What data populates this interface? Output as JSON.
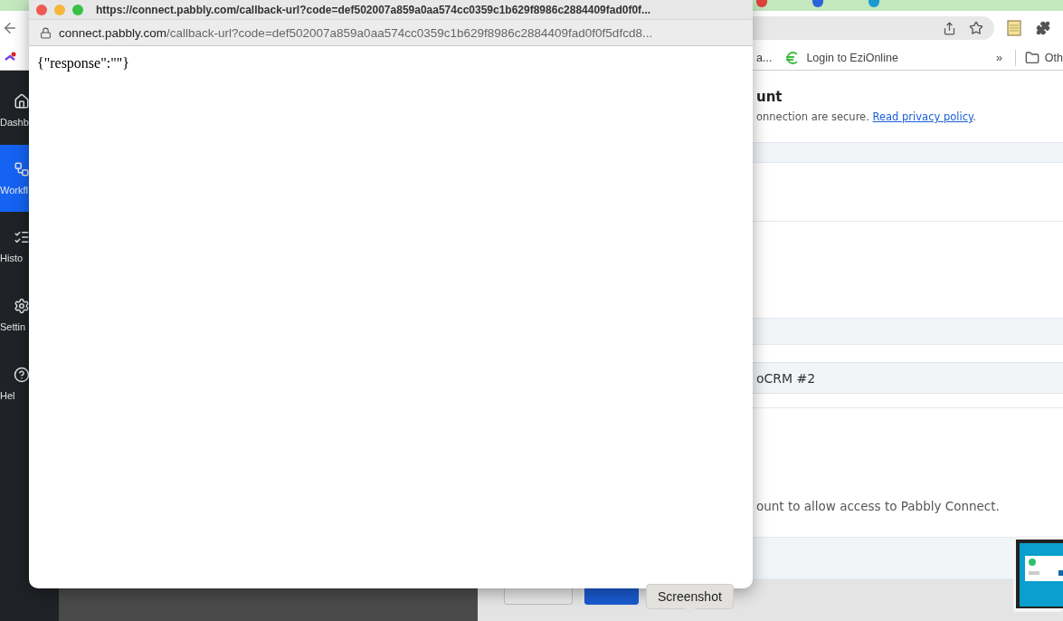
{
  "browser": {
    "bookmarks": [
      {
        "label": "a..."
      },
      {
        "label": "Login to EziOnline"
      }
    ],
    "overflow": "»",
    "other_bookmarks": "Oth"
  },
  "sidebar": {
    "items": [
      {
        "kind": "home",
        "label": "Dashb",
        "selected": false
      },
      {
        "kind": "workflow",
        "label": "Workfl",
        "selected": true
      },
      {
        "kind": "history",
        "label": "Histo",
        "selected": false
      },
      {
        "kind": "settings",
        "label": "Settin",
        "selected": false
      },
      {
        "kind": "help",
        "label": "Hel",
        "selected": false
      }
    ]
  },
  "page": {
    "heading": "unt",
    "notice": "onnection are secure. ",
    "privacy_link": "Read privacy policy",
    "notice_end": ".",
    "app_name": "oCRM #2",
    "instruction": "ount to allow access to Pabbly Connect."
  },
  "popup": {
    "title": "https://connect.pabbly.com/callback-url?code=def502007a859a0aa574cc0359c1b629f8986c2884409fad0f0f...",
    "url_host": "connect.pabbly.com",
    "url_path": "/callback-url?code=def502007a859a0aa574cc0359c1b629f8986c2884409fad0f0f5dfcd8...",
    "body": "{\"response\":\"\"}"
  },
  "tooltip": "Screenshot"
}
